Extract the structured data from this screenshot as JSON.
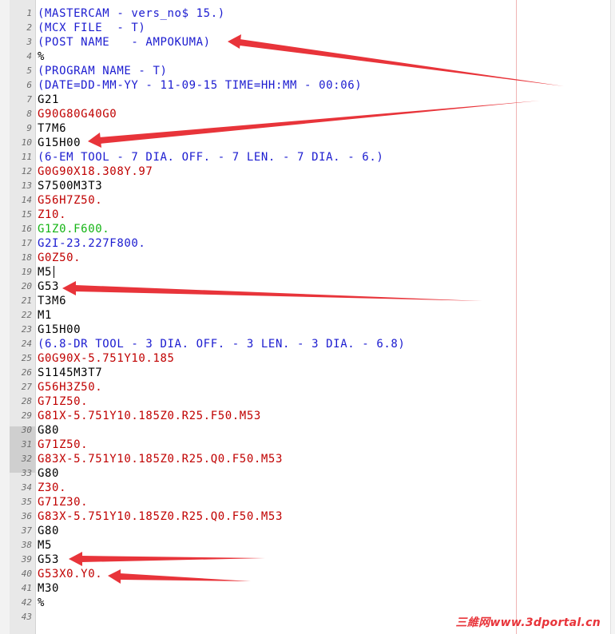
{
  "editor": {
    "colors": {
      "comment": "#1b1bd0",
      "black": "#000000",
      "red": "#c00000",
      "green": "#14b414",
      "blue": "#1b1bd0",
      "arrow": "#e8343a",
      "watermark": "#e8343a"
    },
    "lines": [
      {
        "n": "1",
        "text": "(MASTERCAM - vers_no$ 15.)",
        "c": "comment"
      },
      {
        "n": "2",
        "text": "(MCX FILE  - T)",
        "c": "comment"
      },
      {
        "n": "3",
        "text": "(POST NAME   - AMPOKUMA)",
        "c": "comment"
      },
      {
        "n": "4",
        "text": "%",
        "c": "black"
      },
      {
        "n": "5",
        "text": "(PROGRAM NAME - T)",
        "c": "comment"
      },
      {
        "n": "6",
        "text": "(DATE=DD-MM-YY - 11-09-15 TIME=HH:MM - 00:06)",
        "c": "comment"
      },
      {
        "n": "7",
        "text": "G21",
        "c": "black"
      },
      {
        "n": "8",
        "text": "G90G80G40G0",
        "c": "red"
      },
      {
        "n": "9",
        "text": "T7M6",
        "c": "black"
      },
      {
        "n": "10",
        "text": "G15H00",
        "c": "black"
      },
      {
        "n": "11",
        "text": "(6-EM TOOL - 7 DIA. OFF. - 7 LEN. - 7 DIA. - 6.)",
        "c": "comment"
      },
      {
        "n": "12",
        "text": "G0G90X18.308Y.97",
        "c": "red"
      },
      {
        "n": "13",
        "text": "S7500M3T3",
        "c": "black"
      },
      {
        "n": "14",
        "text": "G56H7Z50.",
        "c": "red"
      },
      {
        "n": "15",
        "text": "Z10.",
        "c": "red"
      },
      {
        "n": "16",
        "text": "G1Z0.F600.",
        "c": "green"
      },
      {
        "n": "17",
        "text": "G2I-23.227F800.",
        "c": "blue"
      },
      {
        "n": "18",
        "text": "G0Z50.",
        "c": "red"
      },
      {
        "n": "19",
        "text": "M5",
        "c": "black"
      },
      {
        "n": "20",
        "text": "G53",
        "c": "black"
      },
      {
        "n": "21",
        "text": "T3M6",
        "c": "black"
      },
      {
        "n": "22",
        "text": "M1",
        "c": "black"
      },
      {
        "n": "23",
        "text": "G15H00",
        "c": "black"
      },
      {
        "n": "24",
        "text": "(6.8-DR TOOL - 3 DIA. OFF. - 3 LEN. - 3 DIA. - 6.8)",
        "c": "comment"
      },
      {
        "n": "25",
        "text": "G0G90X-5.751Y10.185",
        "c": "red"
      },
      {
        "n": "26",
        "text": "S1145M3T7",
        "c": "black"
      },
      {
        "n": "27",
        "text": "G56H3Z50.",
        "c": "red"
      },
      {
        "n": "28",
        "text": "G71Z50.",
        "c": "red"
      },
      {
        "n": "29",
        "text": "G81X-5.751Y10.185Z0.R25.F50.M53",
        "c": "red"
      },
      {
        "n": "30",
        "text": "G80",
        "c": "black"
      },
      {
        "n": "31",
        "text": "G71Z50.",
        "c": "red"
      },
      {
        "n": "32",
        "text": "G83X-5.751Y10.185Z0.R25.Q0.F50.M53",
        "c": "red"
      },
      {
        "n": "33",
        "text": "G80",
        "c": "black"
      },
      {
        "n": "34",
        "text": "Z30.",
        "c": "red"
      },
      {
        "n": "35",
        "text": "G71Z30.",
        "c": "red"
      },
      {
        "n": "36",
        "text": "G83X-5.751Y10.185Z0.R25.Q0.F50.M53",
        "c": "red"
      },
      {
        "n": "37",
        "text": "G80",
        "c": "black"
      },
      {
        "n": "38",
        "text": "M5",
        "c": "black"
      },
      {
        "n": "39",
        "text": "G53",
        "c": "black"
      },
      {
        "n": "40",
        "text": "G53X0.Y0.",
        "c": "red"
      },
      {
        "n": "41",
        "text": "M30",
        "c": "black"
      },
      {
        "n": "42",
        "text": "%",
        "c": "black"
      },
      {
        "n": "43",
        "text": "",
        "c": "black"
      }
    ]
  },
  "watermark": {
    "text": "三維网www.3dportal.cn"
  }
}
